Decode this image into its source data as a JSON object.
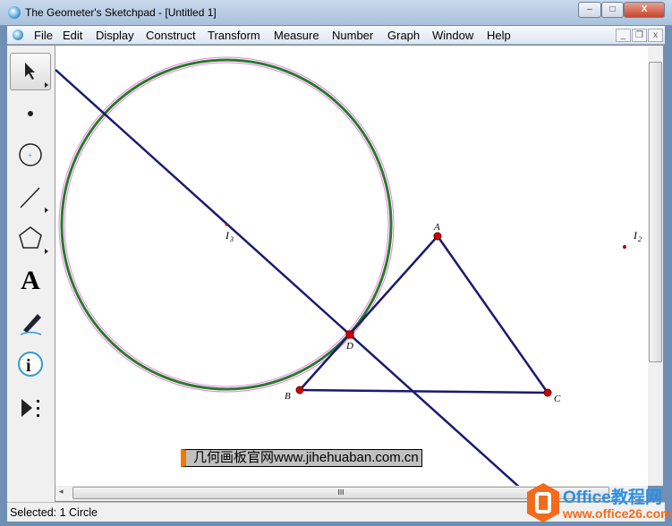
{
  "window": {
    "title": "The Geometer's Sketchpad - [Untitled 1]",
    "min": "–",
    "max": "□",
    "close": "X"
  },
  "menu": [
    "File",
    "Edit",
    "Display",
    "Construct",
    "Transform",
    "Measure",
    "Number",
    "Graph",
    "Window",
    "Help"
  ],
  "mdi": {
    "min": "_",
    "restore": "❐",
    "close": "x"
  },
  "tools": [
    "arrow-select-icon",
    "point-icon",
    "compass-icon",
    "straightedge-icon",
    "polygon-icon",
    "text-icon",
    "marker-icon",
    "information-icon",
    "custom-tool-icon"
  ],
  "tool_text": "A",
  "sketch": {
    "labels": {
      "A": "A",
      "B": "B",
      "C": "C",
      "D": "D",
      "I3": "I",
      "I3sub": "3",
      "I2": "I",
      "I2sub": "2"
    },
    "colors": {
      "segment": "#1a1a6e",
      "point": "#d00000",
      "circle_outer": "#e080e0",
      "circle_inner": "#2a7a2a"
    }
  },
  "watermark": "几何画板官网www.jihehuaban.com.cn",
  "logo": {
    "name": "Office教程网",
    "url": "www.office26.com"
  },
  "scroll_grip": "III",
  "status": "Selected: 1 Circle"
}
